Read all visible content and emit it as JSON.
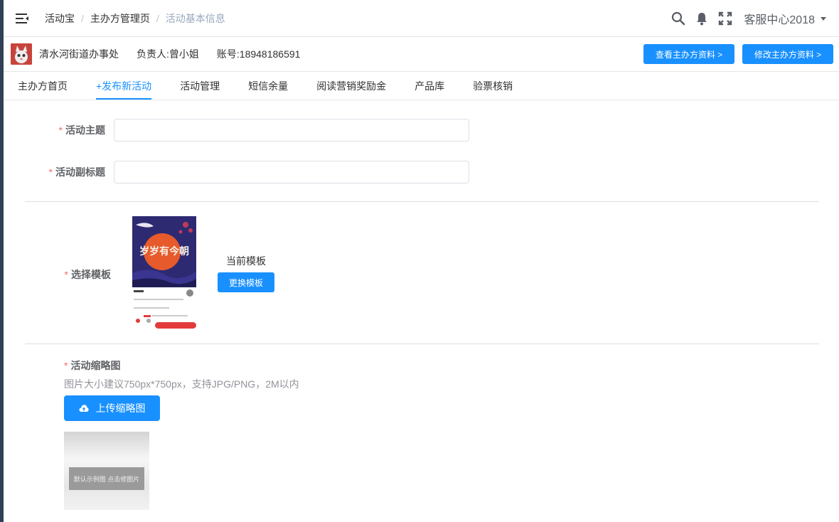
{
  "breadcrumb": [
    "活动宝",
    "主办方管理页",
    "活动基本信息"
  ],
  "header": {
    "user": "客服中心2018"
  },
  "organizer": {
    "name": "清水河街道办事处",
    "contact": "负责人:曾小姐",
    "account": "账号:18948186591",
    "view_btn": "查看主办方资料 >",
    "edit_btn": "修改主办方资料 >"
  },
  "tabs": [
    "主办方首页",
    "+发布新活动",
    "活动管理",
    "短信余量",
    "阅读营销奖励金",
    "产品库",
    "验票核销"
  ],
  "form": {
    "title_label": "活动主题",
    "subtitle_label": "活动副标题",
    "template_label": "选择模板",
    "current_template": "当前模板",
    "change_template_btn": "更换模板",
    "poster_title": "岁岁有今朝",
    "thumb_label": "活动缩略图",
    "thumb_hint": "图片大小建议750px*750px，支持JPG/PNG，2M以内",
    "upload_btn": "上传缩略图",
    "thumb_caption": "默认示例图  点击修图片"
  }
}
